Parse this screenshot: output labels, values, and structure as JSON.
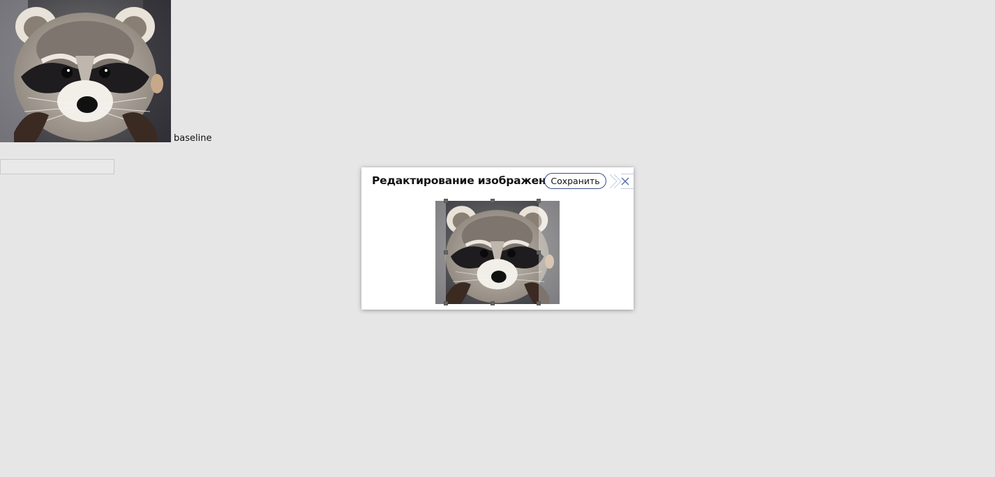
{
  "page": {
    "baseline_label": "baseline",
    "text_input_value": ""
  },
  "dialog": {
    "title": "Редактирование изображения",
    "save_label": "Сохранить",
    "collapse_icon": "chevron-right-icon",
    "close_icon": "close-icon",
    "accent_color": "#3a4d8f"
  },
  "images": {
    "main_image": "raccoon",
    "editor_image": "raccoon"
  }
}
